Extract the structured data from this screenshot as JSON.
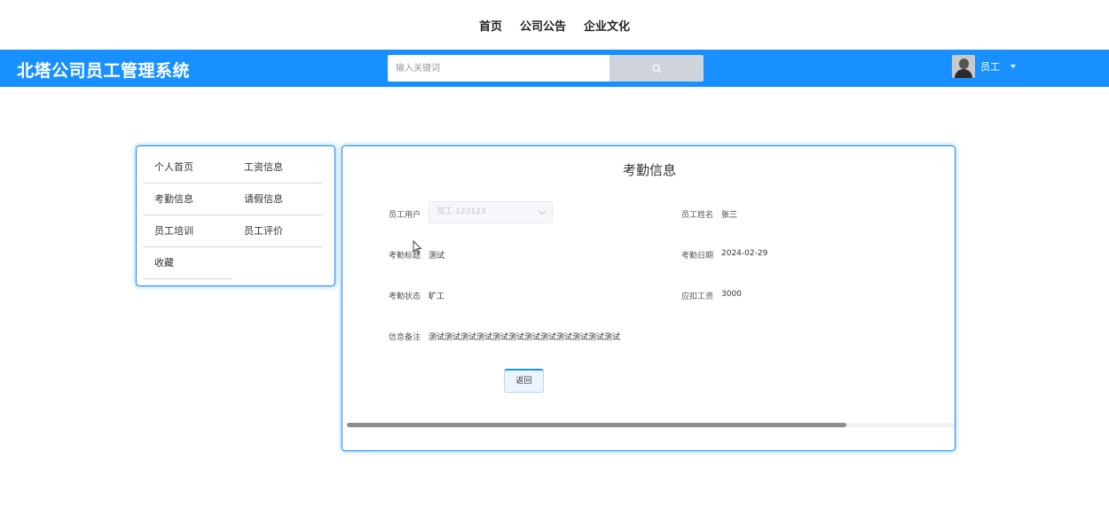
{
  "topnav": {
    "items": [
      "首页",
      "公司公告",
      "企业文化"
    ]
  },
  "header": {
    "brand": "北塔公司员工管理系统",
    "search_placeholder": "输入关键词",
    "user_name": "员工"
  },
  "sidebar": {
    "items": [
      "个人首页",
      "工资信息",
      "考勤信息",
      "请假信息",
      "员工培训",
      "员工评价",
      "收藏"
    ]
  },
  "detail": {
    "title": "考勤信息",
    "employee_user_label": "员工用户",
    "employee_user_value": "员工-123123",
    "employee_name_label": "员工姓名",
    "employee_name_value": "张三",
    "attendance_title_label": "考勤标题",
    "attendance_title_value": "测试",
    "attendance_date_label": "考勤日期",
    "attendance_date_value": "2024-02-29",
    "attendance_status_label": "考勤状态",
    "attendance_status_value": "旷工",
    "deduct_salary_label": "应扣工资",
    "deduct_salary_value": "3000",
    "remark_label": "信息备注",
    "remark_value": "测试测试测试测试测试测试测试测试测试测试测试测试",
    "back_button": "返回"
  },
  "colors": {
    "primary": "#1890ff",
    "search_button": "#cfd4da"
  }
}
